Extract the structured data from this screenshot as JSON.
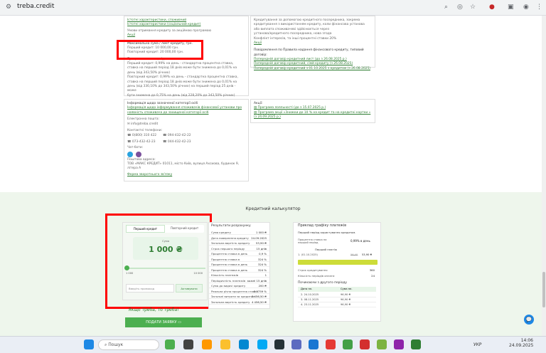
{
  "browser": {
    "url": "treba.credit"
  },
  "top_left": {
    "l1": "Істотні характеристики, споживчий",
    "l2": "Істотні характеристики (соціальний кредит)",
    "l3": "Умови отримання кредиту за акційною програмою",
    "l4": "Акції",
    "max": "Максимальна сума / ліміт кредиту, грн.",
    "first": "Перший кредит: 10 000,00 грн.",
    "repeat": "Повторний кредит: 20 000,00 грн.",
    "rate_title": "Процентна ставка, відсоткова ставка",
    "rate_lines": [
      "Перший кредит: 0,99% на день - стандартна процентна ставка,",
      "ставка на перший період 18 днів може бути знижена до 0,01% на",
      "день (від 343,50% річних)",
      "Повторний кредит: 0,99% на день - стандартна процентна ставка,",
      "ставка на перший період 18 днів може бути знижена до 0,01% на",
      "день (від 330,10% до 343,50% річних) на перший період 25 днів - може",
      "бути знижена до 0,75% на день (від 228,20% до 343,50% річних)"
    ]
  },
  "top_right": {
    "l1": "Кредитування за допомогою кредитного посередника, зокрема",
    "l2": "кредитування з використанням кредиту, коли фінансова установа",
    "l3": "або виплата споживачеві здійснюється через",
    "l4": "установа/кредитного посередника, нова згода",
    "l5": "Конфлікт інтересів, та інші процентні ставки 20%",
    "l6": "Акції",
    "l7": "Повідомлення по Правила надання фінансового кредиту, типовий договір:",
    "links": [
      "Попередній договір кредитний лист (до з 26.08.2025 р.)",
      "Попередній договір кредитний, сімй кредиту (з 26.08.2025)",
      "Попередній договір кредитний з 01.10.2025 з кредитом (з 26.08.2025)"
    ]
  },
  "contact": {
    "title": "Інформація щодо зазначеної категорії осіб",
    "link1": "Інформація щодо інформування споживачів фінансової установи про",
    "link2": "наявність споживача до захищеної категорії осіб",
    "email_label": "Електронна пошта:",
    "email": "info@treba.credit",
    "phones_label": "Контактні телефони:",
    "phones": [
      "0(800) 310 422",
      "094-432-42-22",
      "073-432-42-23",
      "044-432-42-23"
    ],
    "chat_label": "Чат-боти:",
    "addr_label": "Поштова адреса:",
    "addr": "ТОВ «МАКС КРЕДИТ» 01011, місто Київ, вулиця Ахсиова, будинок 9, літера А",
    "form": "Форма зворотнього зв'язку"
  },
  "promo": {
    "title": "Акції:",
    "items": [
      "Програма лояльності (до з 15.07.2025 р.)",
      "Програма акції «Знижки до 10 % на кредит та на кредитні картки » (з 24.09.2025 р.)"
    ]
  },
  "calculator": {
    "title": "Кредитний калькулятор",
    "tab_first": "Перший кредит",
    "tab_repeat": "Повторний кредит",
    "sum_label": "Сума",
    "amount": "1 000 ₴",
    "min": "1 000",
    "max": "10 000",
    "promo_placeholder": "Введіть промокод",
    "promo_apply": "Активувати",
    "slogan": "Якщо треба, то треба!",
    "cta": "ПОДАТИ ЗАЯВКУ"
  },
  "results": {
    "title": "Результати розрахунку",
    "rows": [
      {
        "k": "Сума кредиту",
        "v": "1 000 ₴"
      },
      {
        "k": "Дата повернення кредиту",
        "v": "24.09.2025"
      },
      {
        "k": "Загальна вартість кредиту",
        "v": "53,90 ₴"
      },
      {
        "k": "Строк першого періоду",
        "v": "15 днів"
      },
      {
        "k": "Процентна ставка в день",
        "v": "0,9 %"
      },
      {
        "k": "Процентна ставка в",
        "v": "324 %"
      },
      {
        "k": "Процентна ставка в день",
        "v": "324 %"
      },
      {
        "k": "Процентна ставка в день",
        "v": "324 %"
      },
      {
        "k": "Кількість платежів",
        "v": "1"
      },
      {
        "k": "Періодичність платежів",
        "v": "кожні 15 днів"
      },
      {
        "k": "Сума до видачі кредиту",
        "v": "200 ₴"
      },
      {
        "k": "Реальна річна процентна ставка",
        "v": "3 5759 %"
      },
      {
        "k": "Загальні витрати за кредитом",
        "v": "3 456,50 ₴"
      },
      {
        "k": "Загальна вартість кредиту",
        "v": "4 456,50 ₴"
      }
    ]
  },
  "schedule": {
    "title": "Приклад графіку платежів",
    "subtitle": "Перший період користування кредитом.",
    "rate_k": "Процентна ставка на перший період",
    "rate_v": "0,99% в день",
    "payment_label": "Перший платіж",
    "date": "1. (01.10.2025)",
    "old": "56,40",
    "new": "53,90 ₴",
    "term_k": "Строк кредитування",
    "term_v": "360",
    "count_k": "Кількість періодів оплати",
    "count_v": "24",
    "long_title": "Починаючи з другого періоду",
    "cols": [
      "Дата пл.",
      "Сума пл."
    ],
    "dates": [
      "2. 24.10.2025",
      "3. 08.11.2025",
      "4. 23.11.2025"
    ],
    "sums": [
      "96,90 ₴",
      "96,90 ₴",
      "96,90 ₴"
    ]
  },
  "taskbar": {
    "search": "Пошук",
    "lang": "УКР",
    "time": "14:06",
    "date": "24.09.2025"
  }
}
